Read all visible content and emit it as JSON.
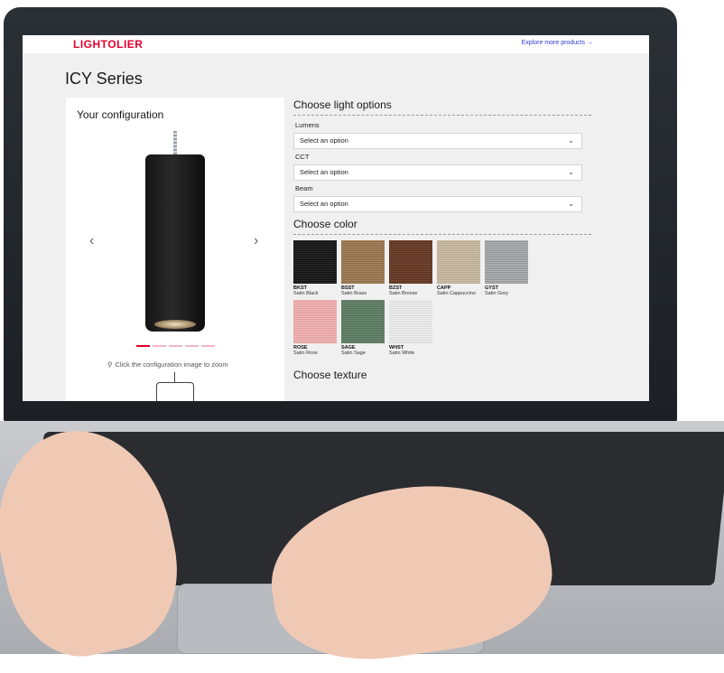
{
  "header": {
    "brand": "LIGHTOLIER",
    "explore_link": "Explore more products →",
    "brand_color": "#e4002b",
    "link_color": "#2b3bd6"
  },
  "page": {
    "title": "ICY Series"
  },
  "configuration": {
    "title": "Your configuration",
    "zoom_hint": "Click the configuration image to zoom",
    "carousel": {
      "slides": 5,
      "active_slide": 1
    },
    "icons": [
      "chevron-left-icon",
      "chevron-right-icon",
      "magnifier-icon"
    ]
  },
  "light_options": {
    "title": "Choose light options",
    "fields": [
      {
        "label": "Lumens",
        "value": "Select an option"
      },
      {
        "label": "CCT",
        "value": "Select an option"
      },
      {
        "label": "Beam",
        "value": "Select an option"
      }
    ]
  },
  "color": {
    "title": "Choose color",
    "swatches": [
      {
        "code": "BKST",
        "name": "Satin Black",
        "color": "#1c1c1c"
      },
      {
        "code": "BSST",
        "name": "Satin Brass",
        "color": "#9a7853"
      },
      {
        "code": "BZST",
        "name": "Satin Bronze",
        "color": "#673d2a"
      },
      {
        "code": "CAPP",
        "name": "Satin Cappuccino",
        "color": "#c3b59d"
      },
      {
        "code": "GYST",
        "name": "Satin Grey",
        "color": "#a2a4a6"
      },
      {
        "code": "ROSE",
        "name": "Satin Rose",
        "color": "#ebabac"
      },
      {
        "code": "SAGE",
        "name": "Satin Sage",
        "color": "#617d66"
      },
      {
        "code": "WHST",
        "name": "Satin White",
        "color": "#e8e8e8"
      }
    ]
  },
  "texture": {
    "title": "Choose texture"
  }
}
